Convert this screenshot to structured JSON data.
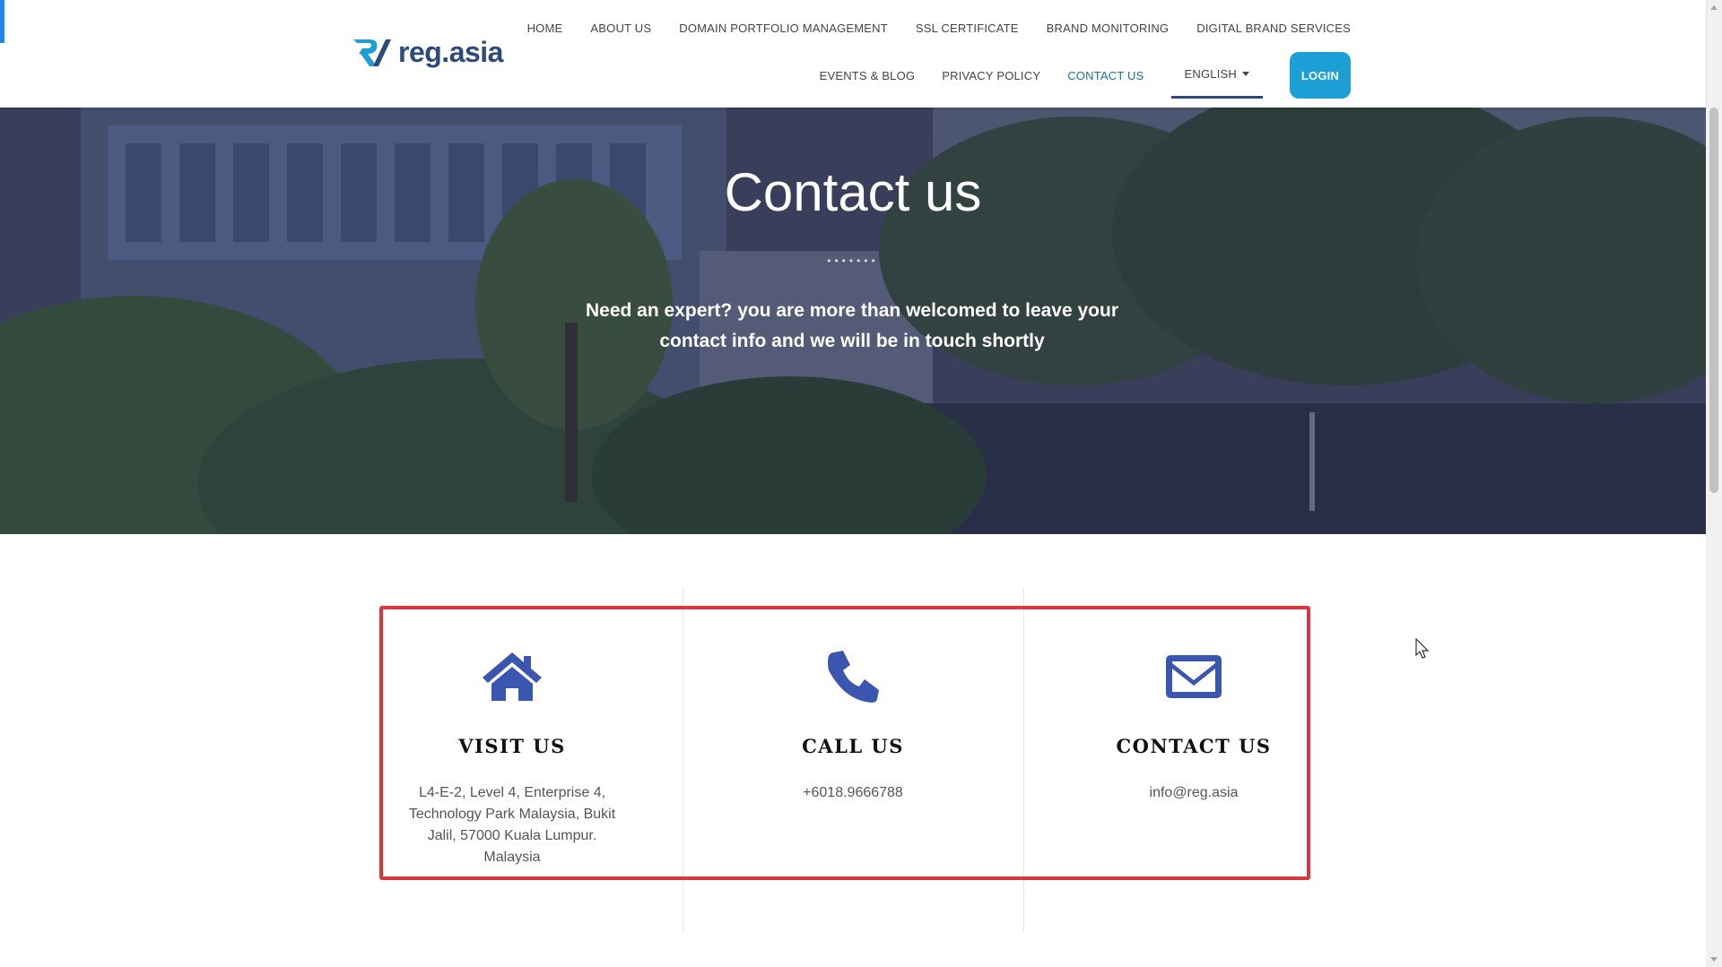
{
  "header": {
    "logo_text": "reg.asia",
    "nav_row1": [
      "HOME",
      "ABOUT US",
      "DOMAIN PORTFOLIO MANAGEMENT",
      "SSL CERTIFICATE",
      "BRAND MONITORING",
      "DIGITAL BRAND SERVICES"
    ],
    "nav_row2": {
      "events": "EVENTS & BLOG",
      "privacy": "PRIVACY POLICY",
      "contact": "CONTACT US",
      "language": "ENGLISH",
      "login": "LOGIN"
    }
  },
  "hero": {
    "title": "Contact us",
    "dots": "•••••••",
    "subtitle": "Need an expert? you are more than welcomed to leave your contact info and we will be in touch shortly"
  },
  "contact": {
    "visit": {
      "icon": "home-icon",
      "title": "VISIT US",
      "text": "L4-E-2, Level 4, Enterprise 4, Technology Park Malaysia, Bukit Jalil, 57000 Kuala Lumpur. Malaysia"
    },
    "call": {
      "icon": "phone-icon",
      "title": "CALL US",
      "text": "+6018.9666788"
    },
    "email": {
      "icon": "envelope-icon",
      "title": "CONTACT US",
      "text": "info@reg.asia"
    }
  },
  "colors": {
    "accent": "#1b9fd4",
    "icon": "#3b56b0",
    "active_nav": "#1a6f9c",
    "highlight_border": "#d9363e"
  }
}
